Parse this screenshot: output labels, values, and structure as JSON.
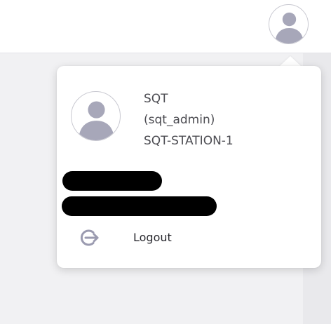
{
  "header": {
    "avatar_icon": "user-avatar-icon"
  },
  "user_menu": {
    "display_name": "SQT",
    "username": "(sqt_admin)",
    "station": "SQT-STATION-1",
    "avatar_icon": "user-avatar-icon",
    "redacted_lines": 2,
    "logout": {
      "label": "Logout",
      "icon": "logout-icon"
    }
  },
  "colors": {
    "avatar_silhouette": "#a7a7b9",
    "icon": "#9b9bb0",
    "text": "#4c4c52",
    "background": "#f1f1f3"
  }
}
